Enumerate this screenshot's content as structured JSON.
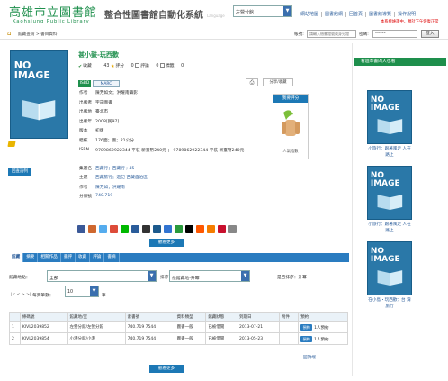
{
  "header": {
    "logo_zh": "高雄市立圖書館",
    "logo_en": "Kaohsiung Public Library",
    "system_title": "整合性圖書館自動化系統",
    "language_label": "Language",
    "library_select": "左營分館",
    "nav": [
      "網站地圖",
      "圖書館網",
      "回首頁",
      "圖書館導覽",
      "操作說明"
    ],
    "notice": "本系統維護中，預計下午恢復正常"
  },
  "crumb_bar": {
    "breadcrumb": "館藏查詢 > 書目資料",
    "account_label": "帳號:",
    "account_placeholder": "請輸入借書證號或身分證",
    "password_label": "密碼:",
    "password_value": "******",
    "login_label": "登入"
  },
  "book": {
    "cover_text": "NO IMAGE",
    "title": "甚小鼓-玩西歡",
    "stats": {
      "favorites_label": "收藏",
      "favorites": "43",
      "reviews_label": "評分",
      "reviews": "0",
      "comments_label": "評論",
      "comments": "0",
      "marks_label": "標籤",
      "marks": "0"
    },
    "tag_isbd": "ISBD",
    "tag_marc": "MARC",
    "print_icon": "print-icon",
    "share_label": "分享/收藏",
    "back_label": "回查詢列",
    "meta": [
      {
        "k": "作者",
        "v": "陳芳如文；洪耀南攝影",
        "link": false
      },
      {
        "k": "出版者",
        "v": "宇宙圖書",
        "link": false
      },
      {
        "k": "出版地",
        "v": "臺北市",
        "link": false
      },
      {
        "k": "出版年",
        "v": "2008[民97]",
        "link": false
      },
      {
        "k": "版本",
        "v": "初版",
        "link": false
      },
      {
        "k": "稽核",
        "v": "176面；圖；21公分",
        "link": false
      },
      {
        "k": "ISBN",
        "v": "9789862922344 平裝 新臺幣240元 ； 9789862922344 平裝 新臺幣240元",
        "link": false
      },
      {
        "k": "集叢名",
        "v": "西藏行；西藏行 ; 45",
        "link": true
      },
      {
        "k": "主題",
        "v": "西藏旅行；遊記-西藏自治區",
        "link": true
      },
      {
        "k": "作者",
        "v": "陳芳如；洪耀南",
        "link": true
      },
      {
        "k": "分類號",
        "v": "740.719",
        "link": true
      }
    ]
  },
  "rating": {
    "title": "我要評分",
    "count": "人氣指數"
  },
  "share_icons": [
    {
      "name": "facebook-icon",
      "color": "#3b5998"
    },
    {
      "name": "plurk-icon",
      "color": "#cf682f"
    },
    {
      "name": "twitter-icon",
      "color": "#55acee"
    },
    {
      "name": "google-icon",
      "color": "#dd4b39"
    },
    {
      "name": "line-icon",
      "color": "#00b900"
    },
    {
      "name": "bookmark-share-icon",
      "color": "#2a5c9a"
    },
    {
      "name": "del-icon",
      "color": "#333333"
    },
    {
      "name": "digg-icon",
      "color": "#1d5a8d"
    },
    {
      "name": "delicious-icon",
      "color": "#3274d1"
    },
    {
      "name": "technorati-icon",
      "color": "#2a9a3c"
    },
    {
      "name": "myspace-icon",
      "color": "#000000"
    },
    {
      "name": "reddit-icon",
      "color": "#ff5700"
    },
    {
      "name": "blogger-icon",
      "color": "#f57d00"
    },
    {
      "name": "mixx-icon",
      "color": "#c8102e"
    },
    {
      "name": "more-share-icon",
      "color": "#888888"
    }
  ],
  "more_label": "觀看更多",
  "tabs": [
    "館藏",
    "摘要",
    "相關作品",
    "書評",
    "收藏",
    "評論",
    "書摘"
  ],
  "filters": {
    "library_label": "館藏地點：",
    "library_value": "全部",
    "sort_label": "排序",
    "sort_value": "依館藏地-升冪",
    "order_label": "是否排序：升冪",
    "page_nav": "|< < > >|",
    "page_size_label": "每頁筆數：",
    "page_size_value": "10",
    "page_unit": "筆"
  },
  "holdings": {
    "columns": [
      "條碼號",
      "館藏地/室",
      "索書號",
      "資料類型",
      "館藏狀態",
      "到期日",
      "附件",
      "預約"
    ],
    "rows": [
      {
        "barcode": "KIVL2039852",
        "location": "左營分館/左營分館",
        "call_no": "740.719 7544",
        "type": "圖書一般",
        "status": "已被借閱",
        "due": "2013-07-21",
        "attach": "",
        "reserve": "預約",
        "queue": "1人預約"
      },
      {
        "barcode": "KIVL2039854",
        "location": "小港分館/小港",
        "call_no": "740.719 7544",
        "type": "圖書一般",
        "status": "已被借閱",
        "due": "2013-05-23",
        "attach": "",
        "reserve": "預約",
        "queue": "1人預約"
      }
    ]
  },
  "back_top": "回頂端",
  "sidebar": {
    "heading": "看過本書的人也看",
    "items": [
      {
        "cover": "NO IMAGE",
        "caption": "小旅行：跟著風走 人在路上"
      },
      {
        "cover": "NO IMAGE",
        "caption": "小旅行：跟著風走 人在路上"
      },
      {
        "cover": "NO IMAGE",
        "caption": "在小島・玩西歡：台 灣旅行"
      }
    ]
  }
}
